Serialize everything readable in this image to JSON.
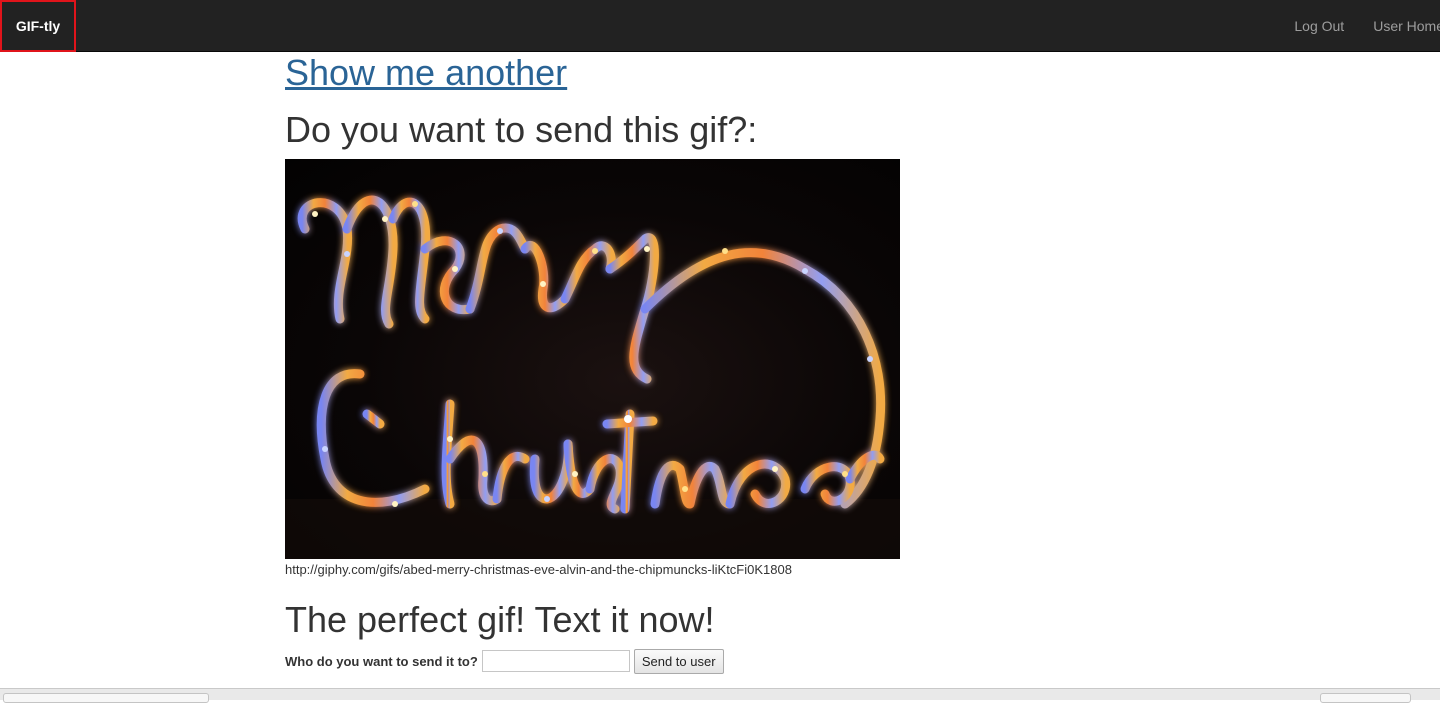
{
  "navbar": {
    "brand": "GIF-tly",
    "links": [
      {
        "label": "Log Out"
      },
      {
        "label": "User Home"
      }
    ]
  },
  "main": {
    "show_another": "Show me another",
    "question": "Do you want to send this gif?:",
    "gif": {
      "text": "Merry Christmas",
      "url": "http://giphy.com/gifs/abed-merry-christmas-eve-alvin-and-the-chipmuncks-liKtcFi0K1808"
    },
    "perfect_heading": "The perfect gif! Text it now!",
    "send_form": {
      "label": "Who do you want to send it to?",
      "input_value": "",
      "button_label": "Send to user"
    }
  },
  "colors": {
    "navbar_bg": "#222222",
    "brand_border": "#e0141b",
    "link": "#2a6496",
    "lights_warm": "#ffb347",
    "lights_cool": "#6b8cff"
  }
}
